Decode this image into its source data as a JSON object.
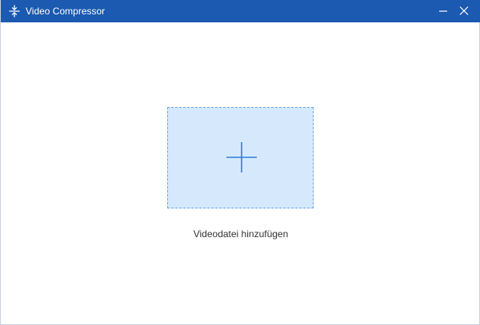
{
  "window": {
    "title": "Video Compressor",
    "app_icon": "compress-icon",
    "minimize_icon": "minimize-icon",
    "close_icon": "close-icon"
  },
  "main": {
    "drop_zone_icon": "plus-icon",
    "add_label": "Videodatei hinzufügen"
  },
  "colors": {
    "titlebar": "#1c59b0",
    "drop_zone_fill": "#d6e9fc",
    "drop_zone_border": "#6aa6e8",
    "plus": "#2f7ed8",
    "label_text": "#333333"
  }
}
